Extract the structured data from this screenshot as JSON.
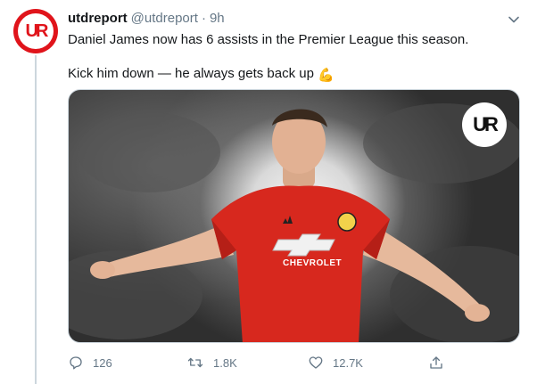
{
  "tweet": {
    "display_name": "utdreport",
    "handle": "@utdreport",
    "separator": "·",
    "time": "9h",
    "line1": "Daniel James now has 6 assists in the Premier League this season.",
    "line2": "Kick him down — he always gets back up",
    "emoji": "💪",
    "avatar_text": "UR",
    "media_logo_text": "UR",
    "media_shirt_text": "CHEVROLET"
  },
  "actions": {
    "replies": "126",
    "retweets": "1.8K",
    "likes": "12.7K"
  },
  "colors": {
    "brand_red": "#e0141b",
    "text_primary": "#14171a",
    "text_secondary": "#657786",
    "divider": "#ccd6dd"
  },
  "icons": [
    "reply-icon",
    "retweet-icon",
    "like-icon",
    "share-icon",
    "chevron-down-icon"
  ]
}
